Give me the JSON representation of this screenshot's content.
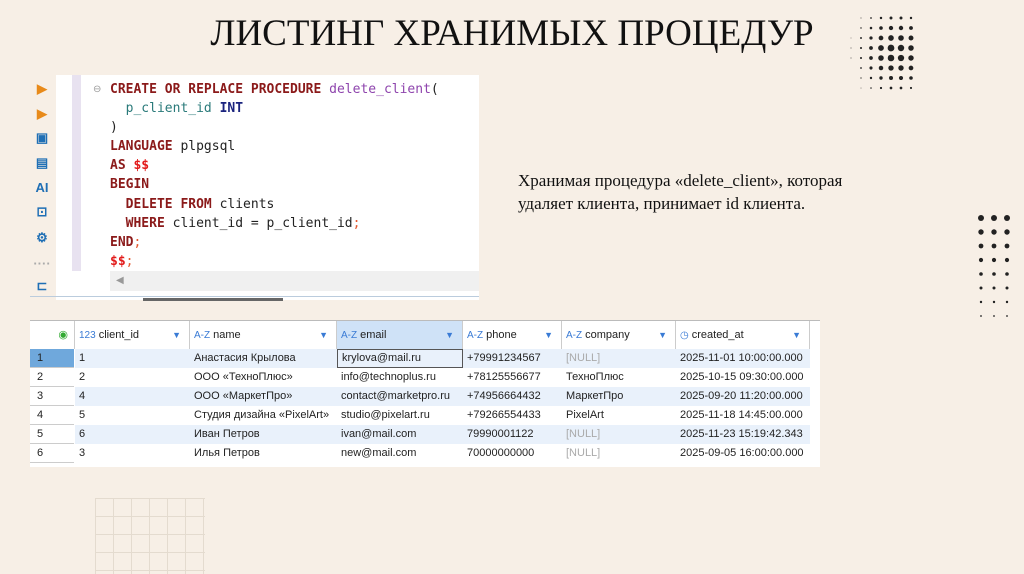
{
  "slide": {
    "title": "ЛИСТИНГ ХРАНИМЫХ ПРОЦЕДУР",
    "description_line1": "Хранимая процедура «delete_client», которая",
    "description_line2": "удаляет клиента, принимает id клиента."
  },
  "editor": {
    "icons": [
      "run-icon",
      "run-add-icon",
      "script-icon",
      "explain-icon",
      "ai-icon",
      "terminal-icon",
      "settings-icon",
      "more-icon",
      "export-icon"
    ]
  },
  "table": {
    "columns": [
      {
        "type": "123",
        "label": "client_id"
      },
      {
        "type": "A-Z",
        "label": "name"
      },
      {
        "type": "A-Z",
        "label": "email"
      },
      {
        "type": "A-Z",
        "label": "phone"
      },
      {
        "type": "A-Z",
        "label": "company"
      },
      {
        "type": "clock",
        "label": "created_at"
      }
    ],
    "rows": [
      {
        "num": "1",
        "cells": [
          "1",
          "Анастасия Крылова",
          "krylova@mail.ru",
          "+79991234567",
          "[NULL]",
          "2025-11-01 10:00:00.000"
        ]
      },
      {
        "num": "2",
        "cells": [
          "2",
          "ООО «ТехноПлюс»",
          "info@technoplus.ru",
          "+78125556677",
          "ТехноПлюс",
          "2025-10-15 09:30:00.000"
        ]
      },
      {
        "num": "3",
        "cells": [
          "4",
          "ООО «МаркетПро»",
          "contact@marketpro.ru",
          "+74956664432",
          "МаркетПро",
          "2025-09-20 11:20:00.000"
        ]
      },
      {
        "num": "4",
        "cells": [
          "5",
          "Студия дизайна «PixelArt»",
          "studio@pixelart.ru",
          "+79266554433",
          "PixelArt",
          "2025-11-18 14:45:00.000"
        ]
      },
      {
        "num": "5",
        "cells": [
          "6",
          "Иван Петров",
          "ivan@mail.com",
          "79990001122",
          "[NULL]",
          "2025-11-23 15:19:42.343"
        ]
      },
      {
        "num": "6",
        "cells": [
          "3",
          "Илья Петров",
          "new@mail.com",
          "70000000000",
          "[NULL]",
          "2025-09-05 16:00:00.000"
        ]
      }
    ]
  }
}
